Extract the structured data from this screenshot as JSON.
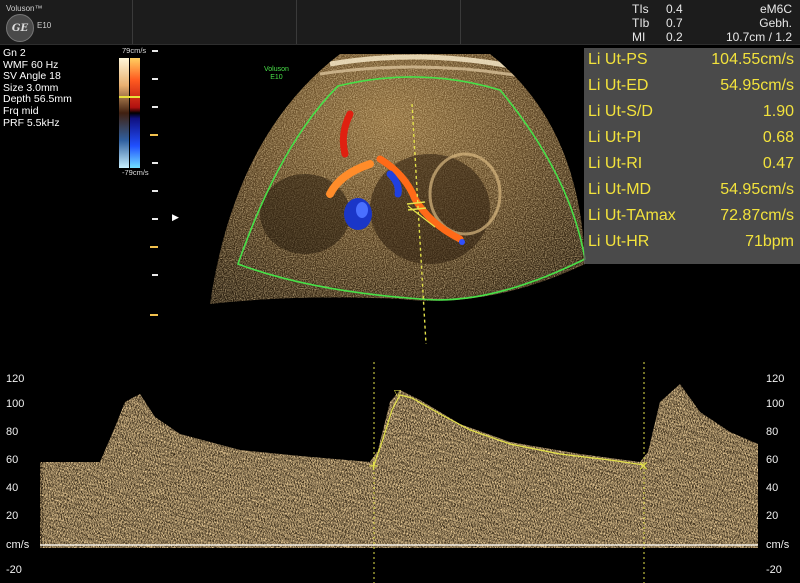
{
  "header": {
    "brand": "Voluson™",
    "logo_text": "GE",
    "model": "E10",
    "params_left": [
      {
        "label": "TIs",
        "value": "0.4"
      },
      {
        "label": "TIb",
        "value": "0.7"
      },
      {
        "label": "MI",
        "value": "0.2"
      }
    ],
    "params_right": [
      "eM6C",
      "Gebh.",
      "10.7cm / 1.2"
    ]
  },
  "side_params": [
    "Gn  2",
    "WMF 60 Hz",
    "SV Angle 18",
    "Size  3.0mm",
    "Depth 56.5mm",
    "Frq mid",
    "PRF  5.5kHz"
  ],
  "color_scale": {
    "max": "79cm/s",
    "min": "-79cm/s"
  },
  "image_label": {
    "line1": "Voluson",
    "line2": "E10"
  },
  "measurements": [
    {
      "label": "Li Ut-PS",
      "value": "104.55cm/s"
    },
    {
      "label": "Li Ut-ED",
      "value": "54.95cm/s"
    },
    {
      "label": "Li Ut-S/D",
      "value": "1.90"
    },
    {
      "label": "Li Ut-PI",
      "value": "0.68"
    },
    {
      "label": "Li Ut-RI",
      "value": "0.47"
    },
    {
      "label": "Li Ut-MD",
      "value": "54.95cm/s"
    },
    {
      "label": "Li Ut-TAmax",
      "value": "72.87cm/s"
    },
    {
      "label": "Li Ut-HR",
      "value": "71bpm"
    }
  ],
  "doppler_axis": {
    "ticks": [
      "120",
      "100",
      "80",
      "60",
      "40",
      "20",
      "cm/s",
      "-20"
    ]
  },
  "colors": {
    "measurement_text": "#f2e23c",
    "sector_outline": "#48e048",
    "trace": "#e4e24a",
    "spectrum": "#e0a65a"
  }
}
